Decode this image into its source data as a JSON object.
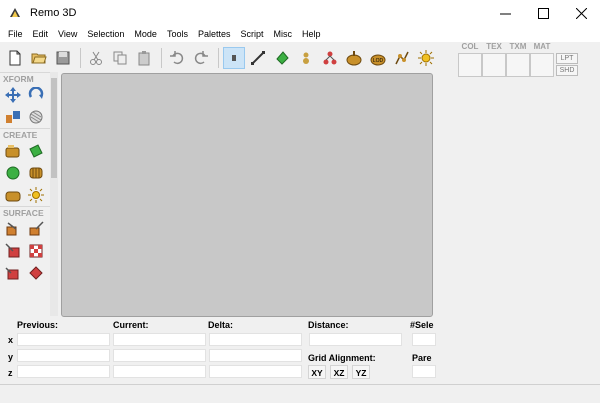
{
  "window": {
    "title": "Remo 3D"
  },
  "menu": [
    "File",
    "Edit",
    "View",
    "Selection",
    "Mode",
    "Tools",
    "Palettes",
    "Script",
    "Misc",
    "Help"
  ],
  "toolbar": {
    "buttons": [
      "new-file-icon",
      "open-folder-icon",
      "save-icon",
      "cut-icon",
      "copy-icon",
      "paste-icon",
      "undo-icon",
      "redo-icon",
      "select-vertex-icon",
      "select-edge-icon",
      "select-face-icon",
      "select-object-icon",
      "select-group-icon",
      "select-node-icon",
      "select-lod-icon",
      "select-dof-icon",
      "select-switch-icon",
      "select-light-icon"
    ],
    "active": "select-vertex-icon"
  },
  "palette": {
    "sections": [
      {
        "label": "XFORM"
      },
      {
        "label": "CREATE"
      },
      {
        "label": "SURFACE"
      }
    ]
  },
  "material_panel": {
    "headers": [
      "COL",
      "TEX",
      "TXM",
      "MAT"
    ],
    "side_buttons": [
      "LPT",
      "SHD"
    ]
  },
  "coords": {
    "columns": [
      "Previous:",
      "Current:",
      "Delta:",
      "Distance:",
      "#Sele"
    ],
    "rows": [
      "x",
      "y",
      "z"
    ],
    "grid_alignment_label": "Grid Alignment:",
    "grid_buttons": [
      "XY",
      "XZ",
      "YZ"
    ],
    "parent_label": "Pare"
  },
  "colors": {
    "viewport": "#c8c8c8",
    "accent": "#0078d7",
    "section_label": "#a0a0a0"
  }
}
